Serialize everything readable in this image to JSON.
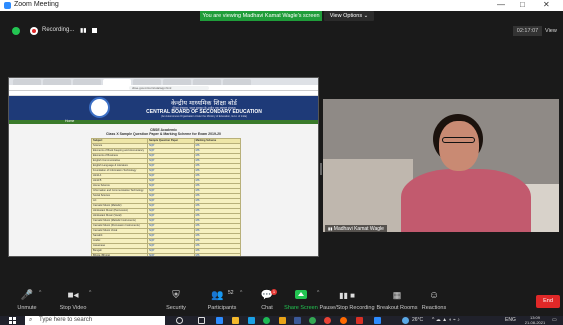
{
  "window": {
    "title": "Zoom Meeting",
    "minimize_glyph": "—",
    "maximize_glyph": "□",
    "close_glyph": "✕"
  },
  "share_banner": {
    "text": "You are viewing Madhavi Kamat Wagle's screen",
    "view_options": "View Options ⌄"
  },
  "recording": {
    "label": "Recording...",
    "pause_glyph": "▮▮",
    "elapsed": "02:17:07",
    "view_label": "View"
  },
  "browser": {
    "url": "cbse.gov.in/curricula/sqp.html",
    "tab_count": 8
  },
  "cbse": {
    "hindi_title": "केन्द्रीय माध्यमिक शिक्षा बोर्ड",
    "hindi_sub": "(शिक्षा मंत्रालय, भारत सरकार के अधीन एक स्वायत्त संगठन)",
    "english_title": "CENTRAL BOARD OF SECONDARY EDUCATION",
    "english_sub": "(An Autonomous Organisation Under the Ministry of Education, Govt. of India)",
    "home_label": "Home",
    "doc_title_1": "CBSE Academic",
    "doc_title_2": "Class X Sample Question Paper & Marking Scheme for Exam 2019-20",
    "table_headers": [
      "Subject",
      "Sample Question Paper",
      "Marking Scheme"
    ],
    "rows": [
      [
        "Science",
        "SQP",
        "MS"
      ],
      [
        "Elements of Book Keeping and Accountancy",
        "SQP",
        "MS"
      ],
      [
        "Elements of Business",
        "SQP",
        "MS"
      ],
      [
        "English Communicative",
        "SQP",
        "MS"
      ],
      [
        "English Language & Literature",
        "SQP",
        "MS"
      ],
      [
        "Foundation of Information Technology",
        "SQP",
        "MS"
      ],
      [
        "Hindi A",
        "SQP",
        "MS"
      ],
      [
        "Hindi B",
        "SQP",
        "MS"
      ],
      [
        "Home Science",
        "SQP",
        "MS"
      ],
      [
        "Information and Communication Technology",
        "SQP",
        "MS"
      ],
      [
        "Social Science",
        "SQP",
        "MS"
      ],
      [
        "Art",
        "SQP",
        "MS"
      ],
      [
        "Carnatic Music (Melodic)",
        "SQP",
        "MS"
      ],
      [
        "Hindustani Music (Percussion)",
        "SQP",
        "MS"
      ],
      [
        "Hindustani Music (Vocal)",
        "SQP",
        "MS"
      ],
      [
        "Carnatic Music (Melodic Instruments)",
        "SQP",
        "MS"
      ],
      [
        "Carnatic Music (Percussion Instruments)",
        "SQP",
        "MS"
      ],
      [
        "Carnatic Music Vocal",
        "SQP",
        "MS"
      ],
      [
        "Sanskrit",
        "SQP",
        "MS"
      ],
      [
        "Arabic",
        "SQP",
        "MS"
      ],
      [
        "Assamese",
        "SQP",
        "MS"
      ],
      [
        "Bengali",
        "SQP",
        "MS"
      ],
      [
        "Bhotia (Bhotia)",
        "SQP",
        "MS"
      ],
      [
        "Bhutia",
        "SQP",
        "MS"
      ],
      [
        "French",
        "SQP",
        "MS"
      ],
      [
        "German",
        "SQP",
        "MS"
      ]
    ]
  },
  "participant": {
    "name": "Madhavi Kamat Wagle"
  },
  "toolbar": {
    "unmute": "Unmute",
    "stop_video": "Stop Video",
    "security": "Security",
    "participants": "Participants",
    "participants_count": "52",
    "chat": "Chat",
    "chat_badge": "1",
    "share_screen": "Share Screen",
    "pause_stop_recording": "Pause/Stop Recording",
    "breakout_rooms": "Breakout Rooms",
    "reactions": "Reactions",
    "end": "End"
  },
  "taskbar": {
    "search_placeholder": "Type here to search",
    "weather": "26°C",
    "language": "ENG",
    "time": "13:09",
    "date": "21-08-2021"
  },
  "colors": {
    "zoom_blue": "#2d8cff",
    "share_green": "#23c552",
    "end_red": "#e02828",
    "cbse_navy": "#1e3a78"
  }
}
